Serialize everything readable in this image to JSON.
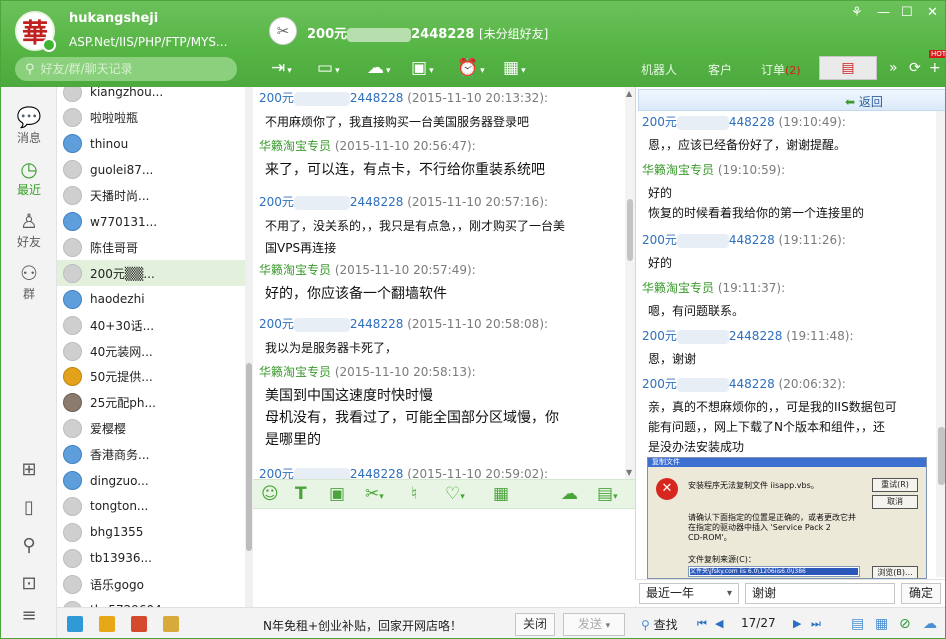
{
  "app": {
    "user_name": "hukangsheji",
    "user_signature": "ASP.Net/IIS/PHP/FTP/MYS...",
    "avatar_char": "華",
    "search_placeholder": "好友/群/聊天记录"
  },
  "conversation": {
    "peer_prefix": "200元",
    "peer_suffix": "2448228",
    "peer_tag": "[未分组好友]",
    "peer_avatar": "✂"
  },
  "toolbar_icons": [
    "share-screen-icon",
    "video-call-icon",
    "chat-add-icon",
    "remote-desktop-icon",
    "alarm-icon",
    "app-icon"
  ],
  "right_tabs": {
    "robot": "机器人",
    "customer": "客户",
    "order": "订单",
    "order_count": "(2)"
  },
  "badges": {
    "hot": "HOT"
  },
  "nav": {
    "messages": "消息",
    "recent": "最近",
    "friends": "好友",
    "groups": "群"
  },
  "contacts": [
    {
      "name": "kiangzhou...",
      "avatar": "gray"
    },
    {
      "name": "啦啦啦瓶",
      "avatar": "gray"
    },
    {
      "name": "thinou",
      "avatar": "blue"
    },
    {
      "name": "guolei87...",
      "avatar": "gray"
    },
    {
      "name": "天播时尚...",
      "avatar": "gray"
    },
    {
      "name": "w770131...",
      "avatar": "blue"
    },
    {
      "name": "陈佳哥哥",
      "avatar": "gray"
    },
    {
      "name": "200元▒▒...",
      "avatar": "gray",
      "selected": true
    },
    {
      "name": "haodezhi",
      "avatar": "blue"
    },
    {
      "name": "40+30话...",
      "avatar": "gray"
    },
    {
      "name": "40元装网...",
      "avatar": "gray"
    },
    {
      "name": "50元提供...",
      "avatar": "gold"
    },
    {
      "name": "25元配ph...",
      "avatar": "photo"
    },
    {
      "name": "爱樱樱",
      "avatar": "gray"
    },
    {
      "name": "香港商务...",
      "avatar": "blue"
    },
    {
      "name": "dingzuo...",
      "avatar": "blue"
    },
    {
      "name": "tongton...",
      "avatar": "gray"
    },
    {
      "name": "bhg1355",
      "avatar": "gray"
    },
    {
      "name": "tb13936...",
      "avatar": "gray"
    },
    {
      "name": "语乐gogo",
      "avatar": "gray"
    },
    {
      "name": "tb_5729604...",
      "avatar": "gray"
    }
  ],
  "messages": [
    {
      "sender_type": "other",
      "sender_prefix": "200元",
      "sender_suffix": "2448228",
      "time": "(2015-11-10 20:13:32):",
      "lines": [
        "不用麻烦你了，我直接购买一台美国服务器登录吧"
      ],
      "size": 12
    },
    {
      "sender_type": "self",
      "sender": "华籁淘宝专员",
      "time": "(2015-11-10 20:56:47):",
      "lines": [
        "来了，可以连，有点卡，不行给你重装系统吧"
      ],
      "size": 14
    },
    {
      "sender_type": "other",
      "sender_prefix": "200元",
      "sender_suffix": "2448228",
      "time": "(2015-11-10 20:57:16):",
      "lines": [
        "不用了，没关系的，，我只是有点急，，刚才购买了一台美",
        "国VPS再连接"
      ],
      "size": 12
    },
    {
      "sender_type": "self",
      "sender": "华籁淘宝专员",
      "time": "(2015-11-10 20:57:49):",
      "lines": [
        "好的，你应该备一个翻墙软件"
      ],
      "size": 14
    },
    {
      "sender_type": "other",
      "sender_prefix": "200元",
      "sender_suffix": "2448228",
      "time": "(2015-11-10 20:58:08):",
      "lines": [
        "我以为是服务器卡死了，"
      ],
      "size": 12
    },
    {
      "sender_type": "self",
      "sender": "华籁淘宝专员",
      "time": "(2015-11-10 20:58:13):",
      "lines": [
        "美国到中国这速度时快时慢",
        "母机没有，我看过了，可能全国部分区域慢，你",
        "是哪里的"
      ],
      "size": 14
    },
    {
      "sender_type": "other",
      "sender_prefix": "200元",
      "sender_suffix": "2448228",
      "time": "(2015-11-10 20:59:02):",
      "lines": [],
      "size": 12
    }
  ],
  "input_icons": [
    "emoji-icon",
    "font-icon",
    "image-icon",
    "screenshot-icon",
    "shake-icon",
    "favorite-icon",
    "more-apps-icon",
    "quick-reply-icon",
    "record-icon"
  ],
  "input_bar": {
    "ad_text": "N年免租+创业补贴，回家开网店咯！",
    "close_label": "关闭",
    "send_label": "发送"
  },
  "history": {
    "back_label": "返回",
    "entries": [
      {
        "sender_type": "other",
        "sender_prefix": "200元",
        "sender_suffix": "448228",
        "time": "(19:10:49):",
        "lines": [
          "恩，，应该已经备份好了，谢谢提醒。"
        ]
      },
      {
        "sender_type": "self",
        "sender": "华籁淘宝专员",
        "time": "(19:10:59):",
        "lines": [
          "好的",
          "恢复的时候看着我给你的第一个连接里的"
        ]
      },
      {
        "sender_type": "other",
        "sender_prefix": "200元",
        "sender_suffix": "448228",
        "time": "(19:11:26):",
        "lines": [
          "好的"
        ]
      },
      {
        "sender_type": "self",
        "sender": "华籁淘宝专员",
        "time": "(19:11:37):",
        "lines": [
          "嗯，有问题联系。"
        ]
      },
      {
        "sender_type": "other",
        "sender_prefix": "200元",
        "sender_suffix": "2448228",
        "time": "(19:11:48):",
        "lines": [
          "恩，谢谢"
        ]
      },
      {
        "sender_type": "other",
        "sender_prefix": "200元",
        "sender_suffix": "448228",
        "time": "(20:06:32):",
        "lines": [
          "亲，真的不想麻烦你的，，可是我的IIS数据包可",
          "能有问题，，网上下载了N个版本和组件，，还",
          "是没办法安装成功"
        ]
      }
    ],
    "dialog": {
      "title": "复制文件",
      "message": "安装程序无法复制文件 iisapp.vbs。",
      "retry": "重试(R)",
      "cancel": "取消",
      "instruction_1": "请确认下面指定的位置是正确的，或者更改它并",
      "instruction_2": "在指定的驱动器中插入 'Service Pack 2",
      "instruction_3": "CD-ROM'。",
      "source_label": "文件复制来源(C)：",
      "source_value": "文件夹\\jfsky.com iis 6.0\\1206iis6.0\\i386",
      "browse": "浏览(B)..."
    },
    "filter_range": "最近一年",
    "search_value": "谢谢",
    "confirm_label": "确定",
    "find_label": "查找",
    "page": "17/27"
  }
}
